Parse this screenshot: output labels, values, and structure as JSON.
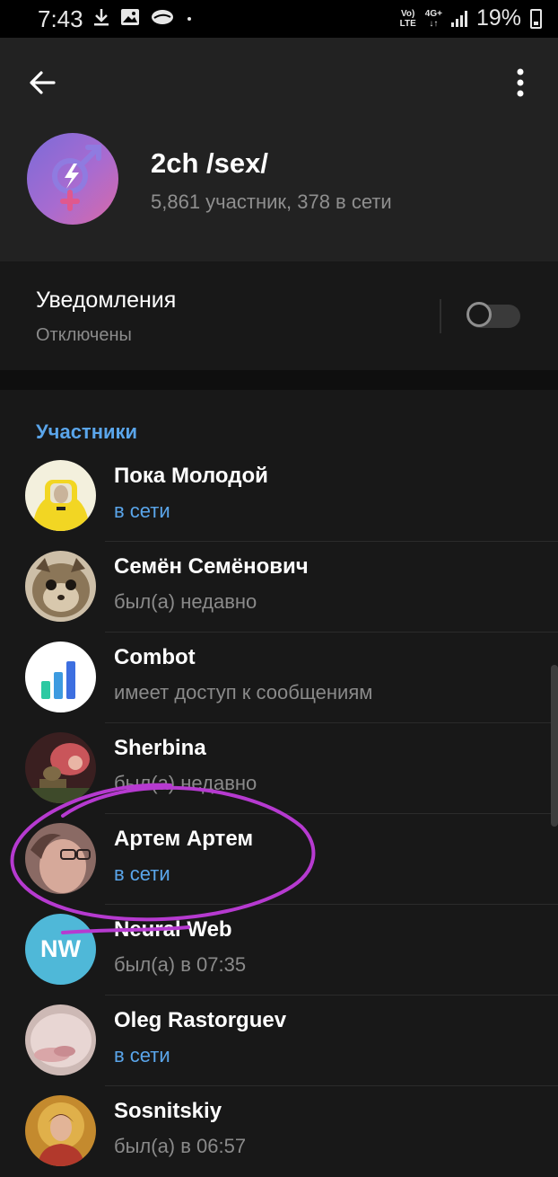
{
  "status_bar": {
    "time": "7:43",
    "net_line1": "Vo)",
    "net_line2": "LTE",
    "net_type": "4G+",
    "battery": "19%"
  },
  "group": {
    "title": "2ch /sex/",
    "subtitle": "5,861 участник, 378 в сети",
    "avatar_icon": "gender-lightning-icon"
  },
  "notifications": {
    "label": "Уведомления",
    "state": "Отключены",
    "enabled": false
  },
  "members": {
    "title": "Участники",
    "items": [
      {
        "name": "Пока Молодой",
        "status": "в сети",
        "online": true
      },
      {
        "name": "Семён Семёнович",
        "status": "был(а) недавно",
        "online": false
      },
      {
        "name": "Combot",
        "status": "имеет доступ к сообщениям",
        "online": false
      },
      {
        "name": "Sherbina",
        "status": "был(а) недавно",
        "online": false
      },
      {
        "name": "Артем Артем",
        "status": "в сети",
        "online": true
      },
      {
        "name": "Neural Web",
        "status": "был(а) в 07:35",
        "online": false,
        "initials": "NW"
      },
      {
        "name": "Oleg Rastorguev",
        "status": "в сети",
        "online": true
      },
      {
        "name": "Sosnitskiy",
        "status": "был(а) в 06:57",
        "online": false
      }
    ]
  },
  "colors": {
    "accent": "#5aa5ea",
    "header_bg": "#222222",
    "page_bg": "#181818",
    "scribble": "#b63ad0",
    "nw_avatar": "#4fb8d8"
  }
}
